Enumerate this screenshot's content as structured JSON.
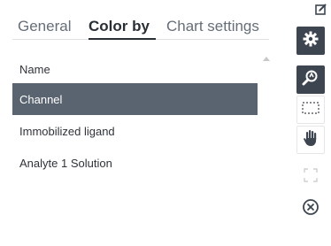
{
  "tabs": {
    "general": "General",
    "color_by": "Color by",
    "chart_settings": "Chart settings",
    "active": "Color by"
  },
  "list": {
    "header": "Name",
    "items": [
      {
        "label": "Channel",
        "selected": true
      },
      {
        "label": "Immobilized ligand",
        "selected": false
      },
      {
        "label": "Analyte 1 Solution",
        "selected": false
      }
    ]
  },
  "toolbar": {
    "icons": [
      "edit-icon",
      "gear-icon",
      "zoom-icon",
      "marquee-select-icon",
      "pan-hand-icon",
      "fit-expand-icon",
      "close-icon"
    ]
  },
  "colors": {
    "selected_row": "#5a6470",
    "toolbar_dark": "#3d4650"
  }
}
